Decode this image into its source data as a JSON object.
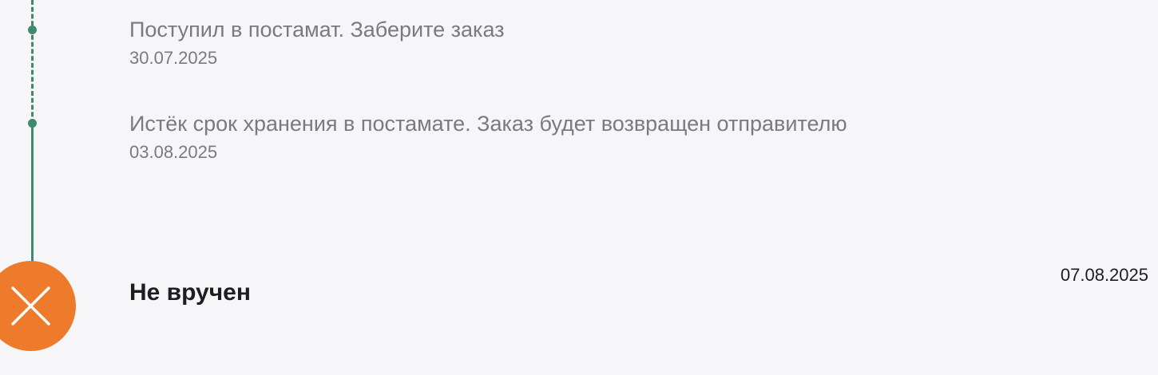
{
  "timeline": {
    "events": [
      {
        "title": "Поступил в постамат. Заберите заказ",
        "date": "30.07.2025"
      },
      {
        "title": "Истёк срок хранения в постамате. Заказ будет возвращен отправителю",
        "date": "03.08.2025"
      }
    ],
    "final_status": {
      "title": "Не вручен",
      "date": "07.08.2025",
      "icon": "close-icon",
      "icon_color": "#ee7b2c"
    },
    "accent_color": "#3f8a6c"
  }
}
